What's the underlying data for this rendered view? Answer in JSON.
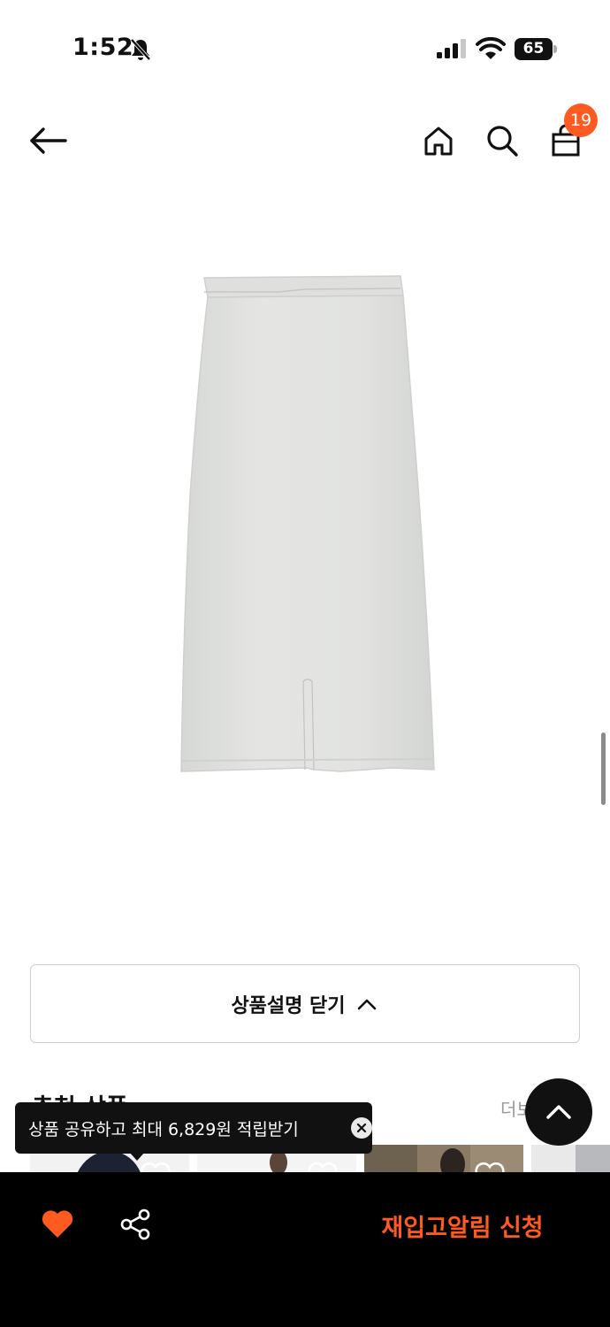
{
  "status_bar": {
    "time": "1:52",
    "battery": "65"
  },
  "header": {
    "cart_count": "19"
  },
  "product": {
    "image_icon": "skirt-image"
  },
  "description_toggle": {
    "label": "상품설명 닫기"
  },
  "recommended": {
    "title": "추천 상품",
    "more_label": "더보기"
  },
  "share_tooltip": {
    "text": "상품 공유하고 최대 6,829원 적립받기"
  },
  "bottom_bar": {
    "restock_label": "재입고알림 신청"
  },
  "colors": {
    "accent": "#ff5a1f",
    "bottom_bar_bg": "#000000"
  }
}
